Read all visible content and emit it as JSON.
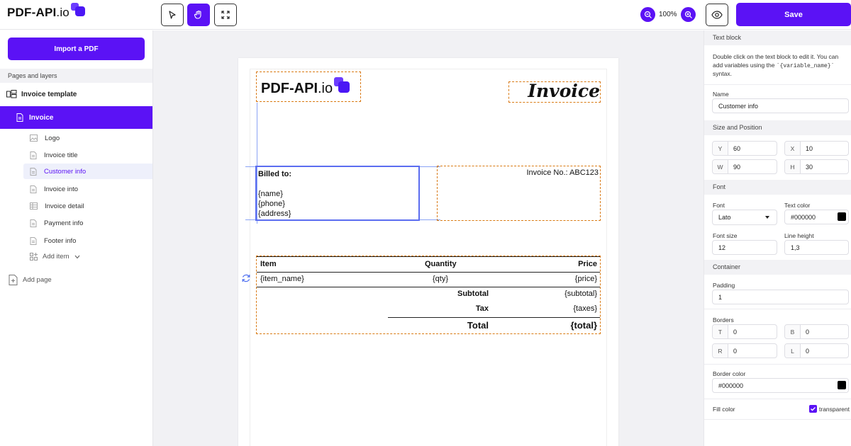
{
  "app": {
    "brand_name": "PDF-API",
    "brand_suffix": ".io",
    "zoom": "100%",
    "save_label": "Save",
    "tools": [
      "select-tool",
      "hand-tool",
      "fit-screen-tool"
    ],
    "accent_color": "#5b12f5"
  },
  "sidebar": {
    "import_label": "Import a PDF",
    "section_label": "Pages and layers",
    "template_name": "Invoice template",
    "page_name": "Invoice",
    "layers": [
      {
        "label": "Logo",
        "icon": "image-icon"
      },
      {
        "label": "Invoice title",
        "icon": "text-icon"
      },
      {
        "label": "Customer info",
        "icon": "text-icon",
        "selected": true
      },
      {
        "label": "Invoice into",
        "icon": "text-icon"
      },
      {
        "label": "Invoice detail",
        "icon": "table-icon"
      },
      {
        "label": "Payment info",
        "icon": "text-icon"
      },
      {
        "label": "Footer info",
        "icon": "text-icon"
      }
    ],
    "add_item_label": "Add item",
    "add_page_label": "Add page"
  },
  "document": {
    "logo_text": "PDF-API",
    "logo_suffix": ".io",
    "title": "Invoice",
    "billed_to_label": "Billed to:",
    "billed_name": "{name}",
    "billed_phone": "{phone}",
    "billed_address": "{address}",
    "invoice_no": "Invoice No.: ABC123",
    "table": {
      "headers": [
        "Item",
        "Quantity",
        "Price"
      ],
      "row": [
        "{item_name}",
        "{qty}",
        "{price}"
      ],
      "subtotal_label": "Subtotal",
      "subtotal_value": "{subtotal}",
      "tax_label": "Tax",
      "tax_value": "{taxes}",
      "total_label": "Total",
      "total_value": "{total}"
    }
  },
  "inspector": {
    "block_type": "Text block",
    "help_line1": "Double click on the text block to edit it. You can",
    "help_line2_pre": "add variables using the ",
    "help_code": "`{variable_name}`",
    "help_line3": "syntax.",
    "name_label": "Name",
    "name_value": "Customer info",
    "size_section": "Size and Position",
    "y_label": "Y",
    "y_value": "60",
    "x_label": "X",
    "x_value": "10",
    "w_label": "W",
    "w_value": "90",
    "h_label": "H",
    "h_value": "30",
    "font_section": "Font",
    "font_label": "Font",
    "font_value": "Lato",
    "text_color_label": "Text color",
    "text_color_value": "#000000",
    "font_size_label": "Font size",
    "font_size_value": "12",
    "line_height_label": "Line height",
    "line_height_value": "1,3",
    "container_section": "Container",
    "padding_label": "Padding",
    "padding_value": "1",
    "borders_label": "Borders",
    "border_t_label": "T",
    "border_t": "0",
    "border_b_label": "B",
    "border_b": "0",
    "border_r_label": "R",
    "border_r": "0",
    "border_l_label": "L",
    "border_l": "0",
    "border_color_label": "Border color",
    "border_color_value": "#000000",
    "fill_color_label": "Fill color",
    "transparent_label": "transparent",
    "transparent_checked": true
  }
}
